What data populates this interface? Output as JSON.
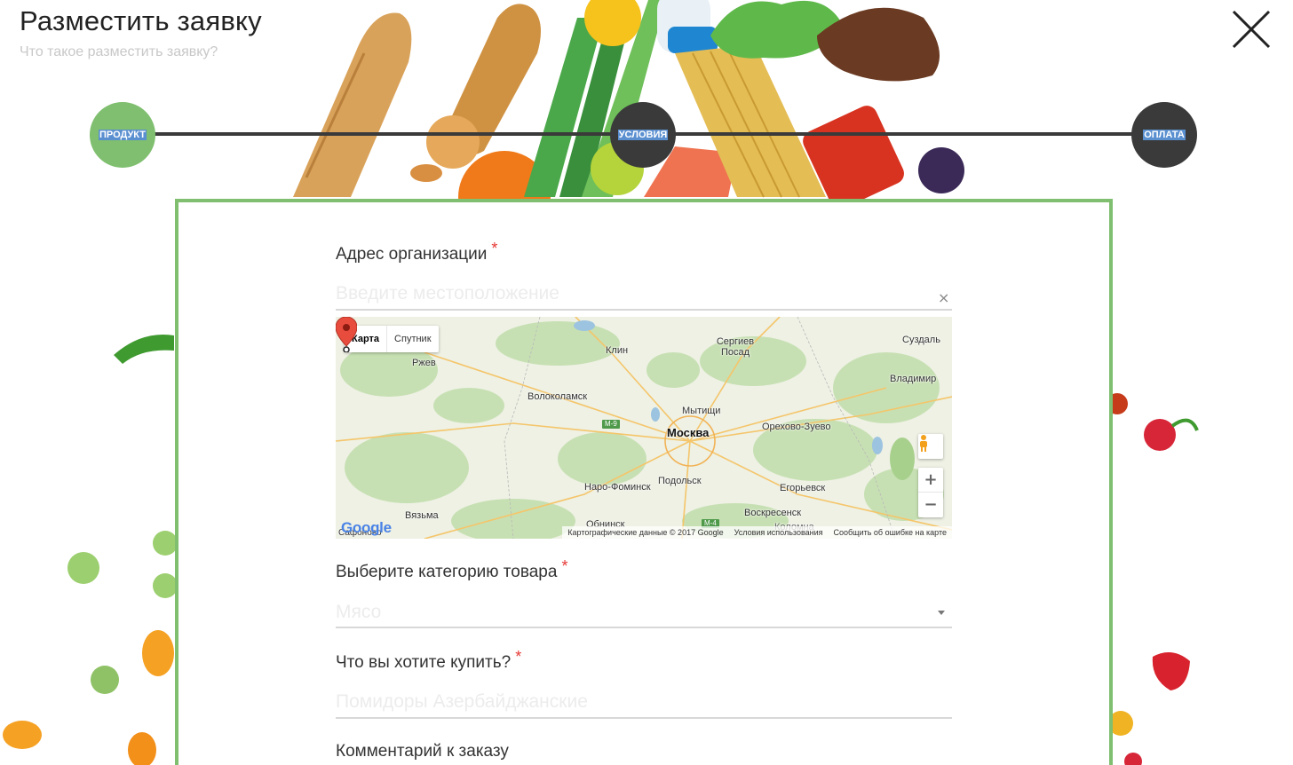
{
  "header": {
    "title": "Разместить заявку",
    "subtitle": "Что такое разместить заявку?"
  },
  "stepper": {
    "steps": [
      {
        "label": "ПРОДУКТ",
        "state": "active",
        "color": "#7fbf6f"
      },
      {
        "label": "УСЛОВИЯ",
        "state": "inactive",
        "color": "#3a3a3a"
      },
      {
        "label": "ОПЛАТА",
        "state": "inactive",
        "color": "#3a3a3a"
      }
    ]
  },
  "form": {
    "address": {
      "label": "Адрес организации",
      "required": "*",
      "placeholder": "Введите местоположение",
      "clear": "×"
    },
    "map": {
      "type_buttons": [
        "Карта",
        "Спутник"
      ],
      "cities": [
        "Клин",
        "Сергиев Посад",
        "Суздаль",
        "Ржев",
        "Волоколамск",
        "Владимир",
        "Мытищи",
        "Москва",
        "Орехово-Зуево",
        "Наро-Фоминск",
        "Подольск",
        "Егорьевск",
        "Воскресенск",
        "Вязьма",
        "Обнинск",
        "Сафоново",
        "Коломна"
      ],
      "road_badges": [
        "M-9",
        "M-4"
      ],
      "zoom_in": "+",
      "zoom_out": "−",
      "logo": "Google",
      "footer": {
        "data": "Картографические данные © 2017 Google",
        "terms": "Условия использования",
        "report": "Сообщить об ошибке на карте"
      }
    },
    "category": {
      "label": "Выберите категорию товара",
      "required": "*",
      "value": "Мясо"
    },
    "product": {
      "label": "Что вы хотите купить?",
      "required": "*",
      "placeholder": "Помидоры Азербайджанские"
    },
    "comment": {
      "label": "Комментарий к заказу"
    }
  },
  "colors": {
    "accent": "#7fbf6f",
    "dark": "#3a3a3a",
    "required": "#e53935"
  },
  "icons": {
    "close": "close-icon",
    "pegman": "pegman-icon",
    "marker": "map-marker-icon",
    "caret": "chevron-down-icon"
  }
}
